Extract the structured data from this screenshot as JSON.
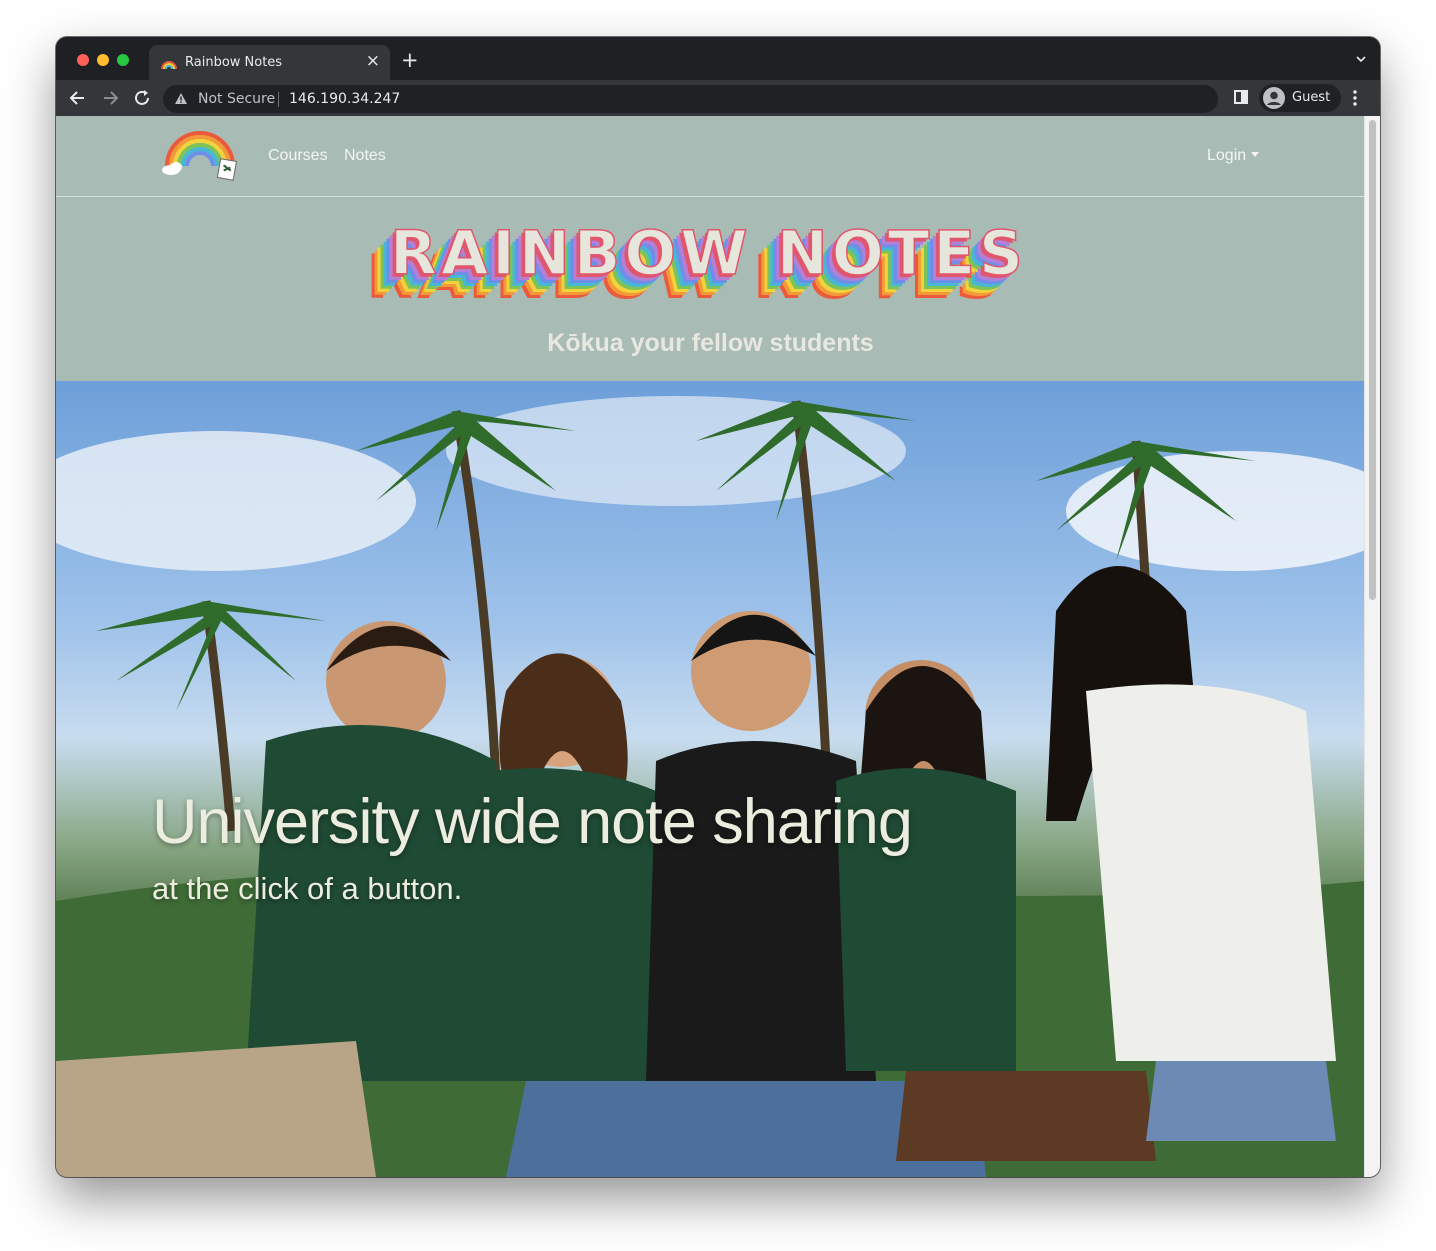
{
  "browser": {
    "tab_title": "Rainbow Notes",
    "tab_close": "×",
    "new_tab": "+",
    "security_label": "Not Secure",
    "url": "146.190.34.247",
    "profile_label": "Guest"
  },
  "navbar": {
    "links": [
      {
        "label": "Courses"
      },
      {
        "label": "Notes"
      }
    ],
    "login_label": "Login"
  },
  "banner": {
    "title": "RAINBOW NOTES",
    "subtitle": "Kōkua your fellow students"
  },
  "hero": {
    "heading": "University wide note sharing",
    "subheading": "at the click of a button."
  },
  "icons": {
    "logo": "rainbow-logo-icon",
    "tab_favicon": "rainbow-favicon-icon",
    "back": "back-arrow-icon",
    "forward": "forward-arrow-icon",
    "reload": "reload-icon",
    "warning": "warning-triangle-icon",
    "side_panel": "side-panel-icon",
    "profile": "avatar-icon",
    "menu": "kebab-menu-icon",
    "tab_search": "chevron-down-icon"
  },
  "colors": {
    "page_background": "#a8bbb4",
    "text_light": "#f3f5f4",
    "rainbow": [
      "#e0566c",
      "#b57fd8",
      "#6e8ee8",
      "#47b7d6",
      "#7cc45a",
      "#f4d23b",
      "#f39a38",
      "#ec5a3c"
    ]
  }
}
